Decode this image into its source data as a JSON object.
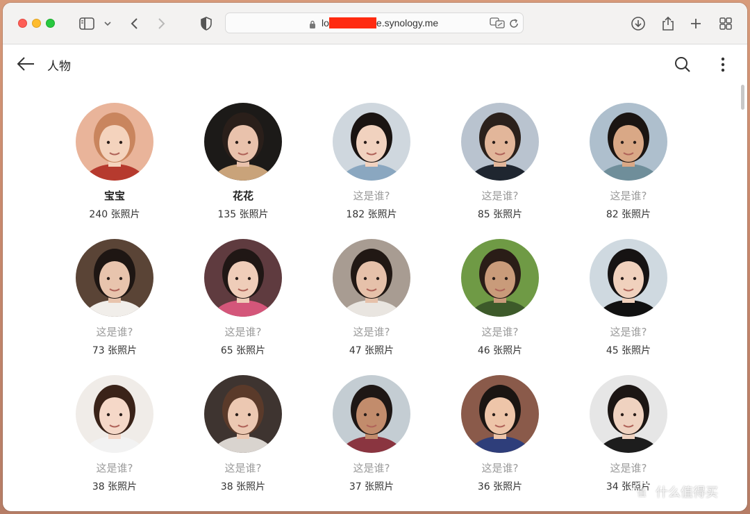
{
  "browser": {
    "url_prefix": "lo",
    "url_suffix": "e.synology.me"
  },
  "app": {
    "title": "人物"
  },
  "people": [
    {
      "name": "宝宝",
      "named": true,
      "count": "240 张照片",
      "bg": "#e9b49a",
      "skin": "#f4d3bd",
      "hair": "#c9855e",
      "accent": "#b63a2e"
    },
    {
      "name": "花花",
      "named": true,
      "count": "135 张照片",
      "bg": "#1c1a18",
      "skin": "#e9c2ac",
      "hair": "#2a1f1a",
      "accent": "#c9a37a"
    },
    {
      "name": "这是谁?",
      "named": false,
      "count": "182 张照片",
      "bg": "#cfd7de",
      "skin": "#f1d2bf",
      "hair": "#1a1412",
      "accent": "#8aa7c0"
    },
    {
      "name": "这是谁?",
      "named": false,
      "count": "85 张照片",
      "bg": "#b9c3cf",
      "skin": "#e2b69a",
      "hair": "#2b211c",
      "accent": "#1f2630"
    },
    {
      "name": "这是谁?",
      "named": false,
      "count": "82 张照片",
      "bg": "#aebfcd",
      "skin": "#d9a886",
      "hair": "#1b1512",
      "accent": "#6f8e9a"
    },
    {
      "name": "这是谁?",
      "named": false,
      "count": "73 张照片",
      "bg": "#5a4436",
      "skin": "#e8c4ad",
      "hair": "#1e1613",
      "accent": "#f1eeea"
    },
    {
      "name": "这是谁?",
      "named": false,
      "count": "65 张照片",
      "bg": "#5f3b3f",
      "skin": "#efcdb9",
      "hair": "#201715",
      "accent": "#d4567a"
    },
    {
      "name": "这是谁?",
      "named": false,
      "count": "47 张照片",
      "bg": "#a89c92",
      "skin": "#e6c1aa",
      "hair": "#211814",
      "accent": "#e9e5e0"
    },
    {
      "name": "这是谁?",
      "named": false,
      "count": "46 张照片",
      "bg": "#6f9a45",
      "skin": "#c99b7a",
      "hair": "#2a1d17",
      "accent": "#3d5a2a"
    },
    {
      "name": "这是谁?",
      "named": false,
      "count": "45 张照片",
      "bg": "#cfd9e0",
      "skin": "#f0d1bd",
      "hair": "#161313",
      "accent": "#111111"
    },
    {
      "name": "这是谁?",
      "named": false,
      "count": "38 张照片",
      "bg": "#f0ece8",
      "skin": "#f5d8c8",
      "hair": "#3a2319",
      "accent": "#f2f2f2"
    },
    {
      "name": "这是谁?",
      "named": false,
      "count": "38 张照片",
      "bg": "#3e3430",
      "skin": "#ecc8b2",
      "hair": "#5a3a2a",
      "accent": "#d9d4cf"
    },
    {
      "name": "这是谁?",
      "named": false,
      "count": "37 张照片",
      "bg": "#c4cdd3",
      "skin": "#c28c6c",
      "hair": "#1e1715",
      "accent": "#8a3540"
    },
    {
      "name": "这是谁?",
      "named": false,
      "count": "36 张照片",
      "bg": "#8a5a4a",
      "skin": "#eec5a9",
      "hair": "#1b1512",
      "accent": "#2e3e7a"
    },
    {
      "name": "这是谁?",
      "named": false,
      "count": "34 张照片",
      "bg": "#e6e6e6",
      "skin": "#efd2c0",
      "hair": "#1c1614",
      "accent": "#1d1d1d"
    }
  ],
  "watermark": {
    "badge": "值",
    "text": "什么值得买"
  }
}
